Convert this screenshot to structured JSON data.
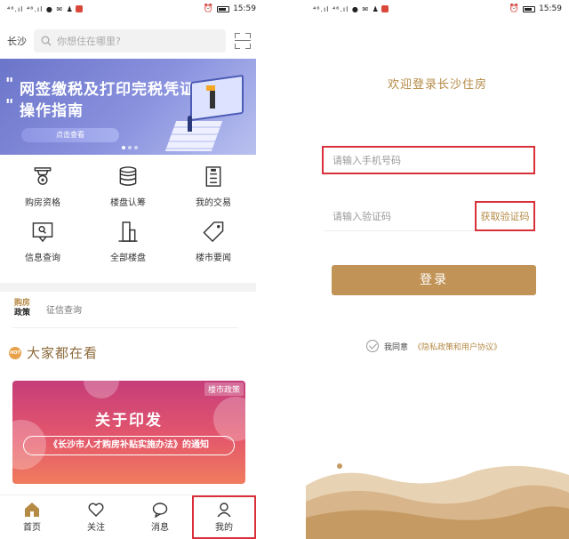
{
  "status_bar": {
    "time": "15:59",
    "left_icons": "⁴⁶.ıl ⁴⁶.ıl ● ✉ ♟"
  },
  "left": {
    "city": "长沙",
    "search_placeholder": "你想住在哪里?",
    "banner": {
      "line1": "网签缴税及打印完税凭证",
      "line2": "操作指南",
      "button": "点击查看"
    },
    "grid": [
      {
        "label": "购房资格",
        "icon": "seal-icon"
      },
      {
        "label": "楼盘认筹",
        "icon": "coin-stack-icon"
      },
      {
        "label": "我的交易",
        "icon": "document-icon"
      },
      {
        "label": "信息查询",
        "icon": "query-icon"
      },
      {
        "label": "全部楼盘",
        "icon": "building-icon"
      },
      {
        "label": "楼市要闻",
        "icon": "tag-icon"
      }
    ],
    "sub_tabs": {
      "active_line1": "购房",
      "active_line2": "政策",
      "other": "征信查询"
    },
    "section_title": "大家都在看",
    "section_badge": "HOT",
    "news": {
      "tag": "楼市政策",
      "title": "关于印发",
      "pill": "《长沙市人才购房补贴实施办法》的通知"
    },
    "bottom_nav": [
      {
        "label": "首页",
        "icon": "home-icon"
      },
      {
        "label": "关注",
        "icon": "heart-icon"
      },
      {
        "label": "消息",
        "icon": "chat-icon"
      },
      {
        "label": "我的",
        "icon": "user-icon"
      }
    ]
  },
  "right": {
    "welcome": "欢迎登录长沙住房",
    "phone_placeholder": "请输入手机号码",
    "code_placeholder": "请输入验证码",
    "get_code": "获取验证码",
    "login": "登录",
    "agree_prefix": "我同意",
    "agree_link": "《隐私政策和用户协议》"
  },
  "colors": {
    "accent": "#b58a45",
    "button": "#c19356",
    "highlight_box": "#d9303a"
  }
}
